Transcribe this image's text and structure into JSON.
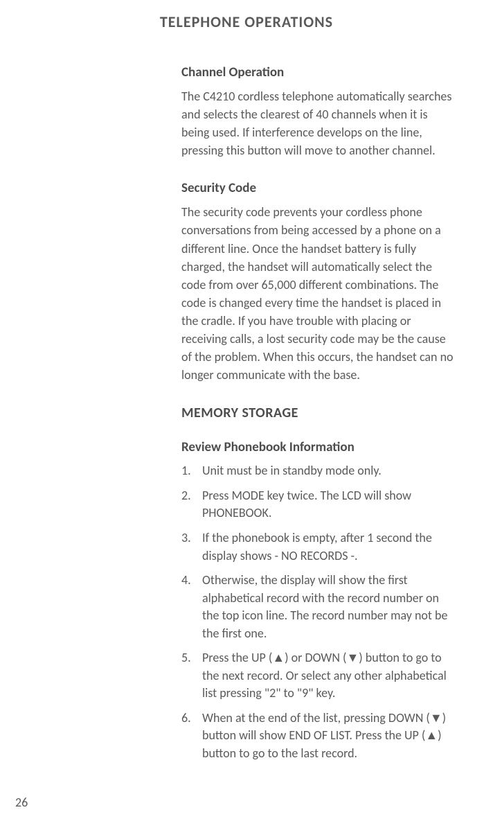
{
  "page_title": "TELEPHONE OPERATIONS",
  "sections": {
    "channel_operation": {
      "heading": "Channel Operation",
      "body": "The C4210 cordless telephone automatically searches and selects the clearest of 40 channels when it is being used. If interference develops on the line, pressing this button will move to another channel."
    },
    "security_code": {
      "heading": "Security Code",
      "body": "The security code prevents your cordless phone conversations from being accessed by a phone on a different line. Once the handset battery is fully charged, the handset will automatically select the code from over 65,000 different combinations. The code is changed every time the handset is placed in the cradle. If you have trouble with placing or receiving calls, a lost security code may be the cause of the problem. When this occurs, the handset can no longer communicate with the base."
    },
    "memory_storage": {
      "heading": "MEMORY STORAGE"
    },
    "review_phonebook": {
      "heading": "Review Phonebook Information",
      "steps": [
        "Unit must be in standby mode only.",
        "Press MODE key twice. The LCD will show PHONEBOOK.",
        "If the phonebook is empty, after 1 second the display shows - NO RECORDS -.",
        "Otherwise, the display will show the first alphabetical record with the record number on the top icon line. The record number may not be the first one.",
        "Press the UP (▲) or DOWN (▼) button to go to the next record. Or select any other alphabetical list pressing \"2\" to \"9\" key.",
        "When at the end of the list, pressing DOWN (▼) button will show END OF LIST. Press the UP (▲) button to go to the last record."
      ]
    }
  },
  "page_number": "26"
}
